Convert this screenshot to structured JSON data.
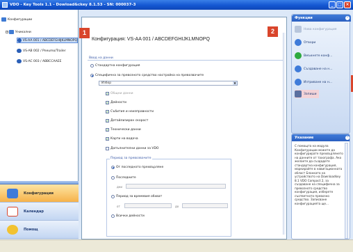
{
  "window": {
    "title": "VDO - Key Tools 1.1 - Dowload&ckey 8.1.53 - SN: 000037-3"
  },
  "tree": {
    "root": "Конфигурации",
    "group": "Уникални",
    "items": [
      "VS-AA 001 / ABCDEFGHIJKLMNOPQ",
      "VS-AB 002 / Pneumo/Trailer",
      "VS-AC 003 / ABBCCAAEE"
    ]
  },
  "nav": {
    "items": [
      {
        "label": "Конфигурации",
        "active": true
      },
      {
        "label": "Календар",
        "active": false
      },
      {
        "label": "Помощ",
        "active": false
      }
    ]
  },
  "main": {
    "title": "Конфигурация: VS-AA 001 / ABCDEFGHIJKLMNOPQ",
    "badge1": "1",
    "badge2": "2",
    "section": "Ввод на данни",
    "radio_standard": "Стандартна конфигурация",
    "radio_specific": "Специфична за превозното средство настройка на превозвачите",
    "select_value": "Избор",
    "checks": [
      {
        "label": "Общни данни",
        "checked": true,
        "disabled": true
      },
      {
        "label": "Дейности",
        "checked": true
      },
      {
        "label": "Събития и неизправности",
        "checked": true
      },
      {
        "label": "Детайлизиран скорост",
        "checked": true
      },
      {
        "label": "Технически данни",
        "checked": true
      },
      {
        "label": "Карти на водача",
        "checked": true
      },
      {
        "label": "Допълнителни данни за VDO",
        "checked": false
      }
    ],
    "period_group": "Период за превозвачите",
    "period_options": [
      {
        "label": "От последното прехвърляне",
        "selected": true
      },
      {
        "label": "Последните",
        "selected": false
      },
      {
        "label": "Период за времевия обхват",
        "selected": false
      },
      {
        "label": "Всички дейности",
        "selected": false
      }
    ],
    "days_label": "дни",
    "from_label": "от",
    "to_label": "до"
  },
  "tasks": {
    "title": "Функции",
    "items": [
      {
        "label": "Нова конфигурация",
        "disabled": true
      },
      {
        "label": "Отвори",
        "disabled": false
      },
      {
        "label": "Вмъкнете конф...",
        "disabled": false
      },
      {
        "label": "Създаване на н...",
        "disabled": false
      },
      {
        "label": "Изтриване на н...",
        "disabled": false
      },
      {
        "label": "Запиши",
        "disabled": false,
        "active": true
      }
    ]
  },
  "info": {
    "title": "Указание",
    "text": "С помощта на модула Конфигурации можете да конфигурирате прехвърлянето на данните от тахографа. Ако желаете да създадете стандартна конфигурация, маркирайте в навигационната област Бланката на устройството на Downloadkey 8.1 VDO Compact 2, за създаване на специфична за превозното средство конфигурация, изберете съответното превозно средство. Записване конфигурацията ще..."
  }
}
